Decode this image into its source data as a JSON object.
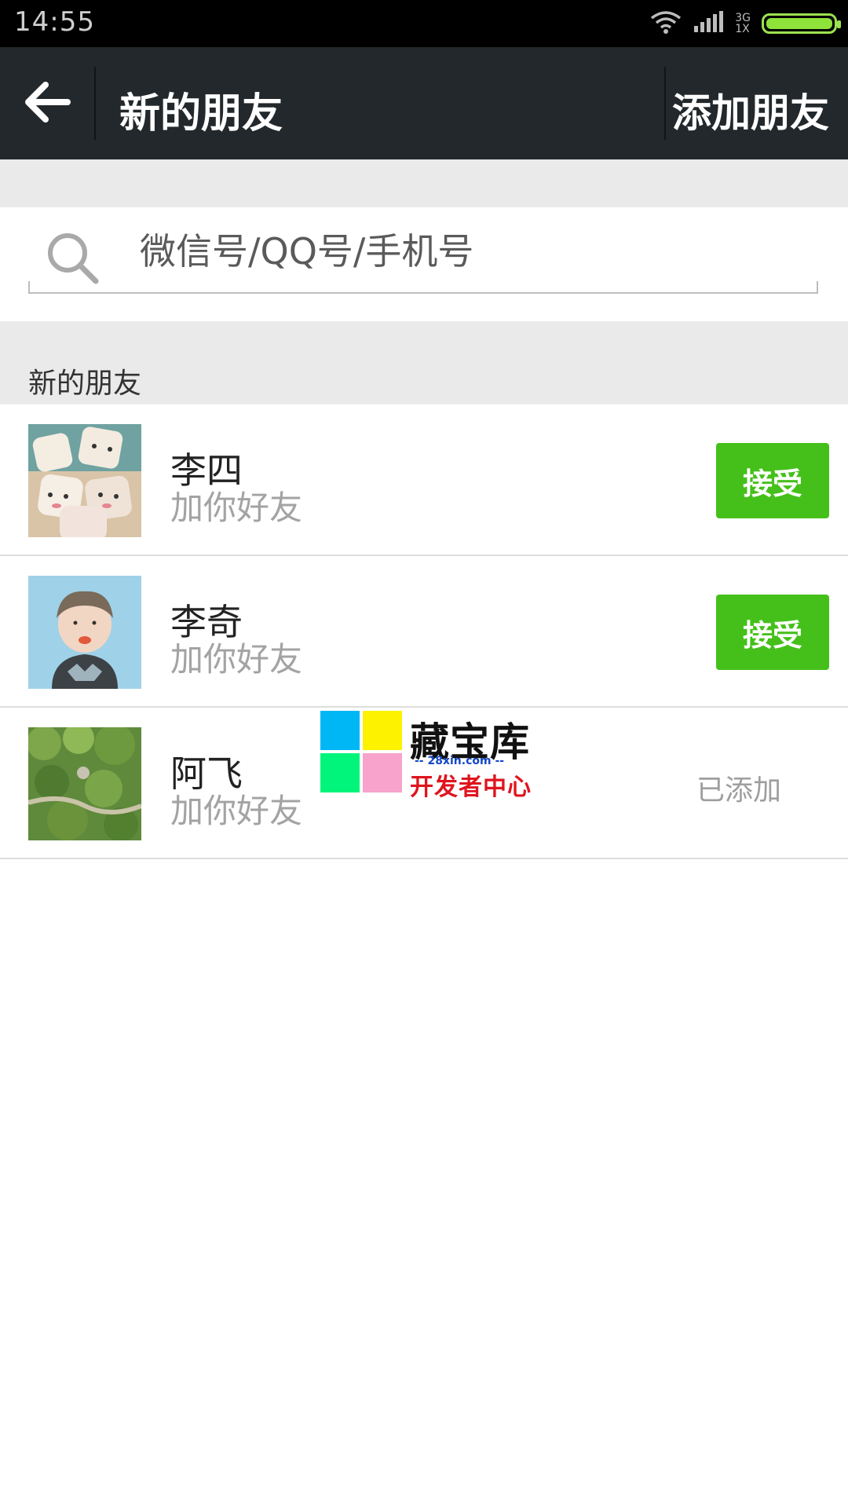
{
  "status_bar": {
    "time": "14:55",
    "network_top": "3G",
    "network_bottom": "1X",
    "icons": [
      "wifi-icon",
      "signal-icon",
      "battery-icon"
    ],
    "battery_level": 1.0
  },
  "app_bar": {
    "title": "新的朋友",
    "action_label": "添加朋友",
    "back_icon": "arrow-left-icon"
  },
  "search": {
    "placeholder": "微信号/QQ号/手机号",
    "icon": "search-icon"
  },
  "section": {
    "title": "新的朋友"
  },
  "friends": [
    {
      "name": "李四",
      "subtitle": "加你好友",
      "action": "接受",
      "status": "pending"
    },
    {
      "name": "李奇",
      "subtitle": "加你好友",
      "action": "接受",
      "status": "pending"
    },
    {
      "name": "阿飞",
      "subtitle": "加你好友",
      "status_label": "已添加",
      "status": "added"
    }
  ],
  "watermark": {
    "title": "藏宝库",
    "url": "-- 28xin.com --",
    "subtitle": "开发者中心"
  },
  "colors": {
    "app_bar": "#22282b",
    "accent_green": "#45c01a",
    "section_bg": "#eaeaea"
  }
}
